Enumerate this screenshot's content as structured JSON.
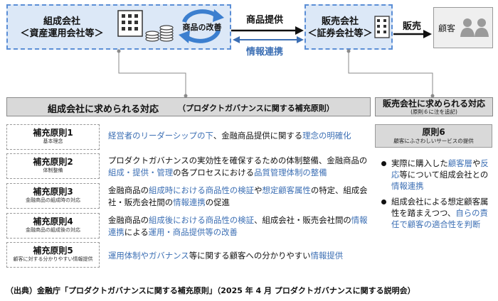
{
  "top": {
    "issuer": {
      "line1": "組成会社",
      "line2": "＜資産運用会社等＞"
    },
    "improvement_label": "商品の改善",
    "flow_product": "商品提供",
    "flow_info": "情報連携",
    "distributor": {
      "line1": "販売会社",
      "line2": "＜証券会社等＞"
    },
    "flow_sale": "販売",
    "customer": "顧客"
  },
  "left_header": {
    "title": "組成会社に求められる対応",
    "subtitle": "（プロダクトガバナンスに関する補充原則）"
  },
  "right_header": {
    "title": "販売会社に求められる対応",
    "subtitle": "(原則６に注を追記)"
  },
  "principles": [
    {
      "title": "補充原則1",
      "sub": "基本理念",
      "desc": [
        {
          "t": "経営者のリーダーシップの下",
          "hl": true
        },
        {
          "t": "、金融商品提供に関する",
          "hl": false
        },
        {
          "t": "理念の明確化",
          "hl": true
        }
      ]
    },
    {
      "title": "補充原則2",
      "sub": "体制整備",
      "desc": [
        {
          "t": "プロダクトガバナンスの実効性を確保するための体制整備、金融商品の",
          "hl": false
        },
        {
          "t": "組成・提供・管理",
          "hl": true
        },
        {
          "t": "の各プロセスにおける",
          "hl": false
        },
        {
          "t": "品質管理体制の整備",
          "hl": true
        }
      ]
    },
    {
      "title": "補充原則3",
      "sub": "金融商品の組成時の対応",
      "desc": [
        {
          "t": "金融商品の",
          "hl": false
        },
        {
          "t": "組成時における商品性の検証",
          "hl": true
        },
        {
          "t": "や",
          "hl": false
        },
        {
          "t": "想定顧客属性",
          "hl": true
        },
        {
          "t": "の特定、組成会社・販売会社間の",
          "hl": false
        },
        {
          "t": "情報連携",
          "hl": true
        },
        {
          "t": "の促進",
          "hl": false
        }
      ]
    },
    {
      "title": "補充原則4",
      "sub": "金融商品の組成後の対応",
      "desc": [
        {
          "t": "金融商品の",
          "hl": false
        },
        {
          "t": "組成後における商品性の検証",
          "hl": true
        },
        {
          "t": "、組成会社・販売会社間の",
          "hl": false
        },
        {
          "t": "情報連携",
          "hl": true
        },
        {
          "t": "による",
          "hl": false
        },
        {
          "t": "運用・商品提供等の改善",
          "hl": true
        }
      ]
    },
    {
      "title": "補充原則5",
      "sub": "顧客に対する分かりやすい情報提供",
      "desc": [
        {
          "t": "運用体制やガバナンス",
          "hl": true
        },
        {
          "t": "等に関する顧客への分かりやすい",
          "hl": false
        },
        {
          "t": "情報提供",
          "hl": true
        }
      ]
    }
  ],
  "principle6": {
    "title": "原則6",
    "sub": "顧客にふさわしいサービスの提供"
  },
  "bullets": [
    [
      {
        "t": "実際に購入した",
        "hl": false
      },
      {
        "t": "顧客層",
        "hl": true
      },
      {
        "t": "や",
        "hl": false
      },
      {
        "t": "反応",
        "hl": true
      },
      {
        "t": "等について組成会社との",
        "hl": false
      },
      {
        "t": "情報連携",
        "hl": true
      }
    ],
    [
      {
        "t": "組成会社による想定顧客属性を踏まえつつ、",
        "hl": false
      },
      {
        "t": "自らの責任で顧客の適合性を判断",
        "hl": true
      }
    ]
  ],
  "footer": "（出典）金融庁「プロダクトガバナンスに関する補充原則」（2025 年 4 月 プロダクトガバナンスに関する説明会）",
  "colors": {
    "accent": "#3c6fb4",
    "box_fill": "#dce8f7",
    "header_fill": "#d9d9d9"
  }
}
